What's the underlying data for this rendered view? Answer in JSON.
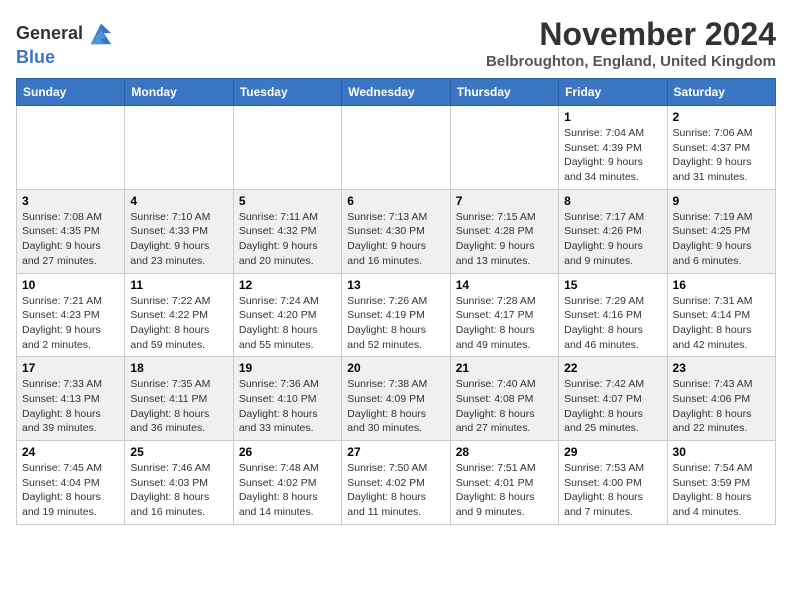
{
  "logo": {
    "line1": "General",
    "line2": "Blue"
  },
  "title": "November 2024",
  "subtitle": "Belbroughton, England, United Kingdom",
  "weekdays": [
    "Sunday",
    "Monday",
    "Tuesday",
    "Wednesday",
    "Thursday",
    "Friday",
    "Saturday"
  ],
  "weeks": [
    [
      {
        "day": "",
        "info": ""
      },
      {
        "day": "",
        "info": ""
      },
      {
        "day": "",
        "info": ""
      },
      {
        "day": "",
        "info": ""
      },
      {
        "day": "",
        "info": ""
      },
      {
        "day": "1",
        "info": "Sunrise: 7:04 AM\nSunset: 4:39 PM\nDaylight: 9 hours and 34 minutes."
      },
      {
        "day": "2",
        "info": "Sunrise: 7:06 AM\nSunset: 4:37 PM\nDaylight: 9 hours and 31 minutes."
      }
    ],
    [
      {
        "day": "3",
        "info": "Sunrise: 7:08 AM\nSunset: 4:35 PM\nDaylight: 9 hours and 27 minutes."
      },
      {
        "day": "4",
        "info": "Sunrise: 7:10 AM\nSunset: 4:33 PM\nDaylight: 9 hours and 23 minutes."
      },
      {
        "day": "5",
        "info": "Sunrise: 7:11 AM\nSunset: 4:32 PM\nDaylight: 9 hours and 20 minutes."
      },
      {
        "day": "6",
        "info": "Sunrise: 7:13 AM\nSunset: 4:30 PM\nDaylight: 9 hours and 16 minutes."
      },
      {
        "day": "7",
        "info": "Sunrise: 7:15 AM\nSunset: 4:28 PM\nDaylight: 9 hours and 13 minutes."
      },
      {
        "day": "8",
        "info": "Sunrise: 7:17 AM\nSunset: 4:26 PM\nDaylight: 9 hours and 9 minutes."
      },
      {
        "day": "9",
        "info": "Sunrise: 7:19 AM\nSunset: 4:25 PM\nDaylight: 9 hours and 6 minutes."
      }
    ],
    [
      {
        "day": "10",
        "info": "Sunrise: 7:21 AM\nSunset: 4:23 PM\nDaylight: 9 hours and 2 minutes."
      },
      {
        "day": "11",
        "info": "Sunrise: 7:22 AM\nSunset: 4:22 PM\nDaylight: 8 hours and 59 minutes."
      },
      {
        "day": "12",
        "info": "Sunrise: 7:24 AM\nSunset: 4:20 PM\nDaylight: 8 hours and 55 minutes."
      },
      {
        "day": "13",
        "info": "Sunrise: 7:26 AM\nSunset: 4:19 PM\nDaylight: 8 hours and 52 minutes."
      },
      {
        "day": "14",
        "info": "Sunrise: 7:28 AM\nSunset: 4:17 PM\nDaylight: 8 hours and 49 minutes."
      },
      {
        "day": "15",
        "info": "Sunrise: 7:29 AM\nSunset: 4:16 PM\nDaylight: 8 hours and 46 minutes."
      },
      {
        "day": "16",
        "info": "Sunrise: 7:31 AM\nSunset: 4:14 PM\nDaylight: 8 hours and 42 minutes."
      }
    ],
    [
      {
        "day": "17",
        "info": "Sunrise: 7:33 AM\nSunset: 4:13 PM\nDaylight: 8 hours and 39 minutes."
      },
      {
        "day": "18",
        "info": "Sunrise: 7:35 AM\nSunset: 4:11 PM\nDaylight: 8 hours and 36 minutes."
      },
      {
        "day": "19",
        "info": "Sunrise: 7:36 AM\nSunset: 4:10 PM\nDaylight: 8 hours and 33 minutes."
      },
      {
        "day": "20",
        "info": "Sunrise: 7:38 AM\nSunset: 4:09 PM\nDaylight: 8 hours and 30 minutes."
      },
      {
        "day": "21",
        "info": "Sunrise: 7:40 AM\nSunset: 4:08 PM\nDaylight: 8 hours and 27 minutes."
      },
      {
        "day": "22",
        "info": "Sunrise: 7:42 AM\nSunset: 4:07 PM\nDaylight: 8 hours and 25 minutes."
      },
      {
        "day": "23",
        "info": "Sunrise: 7:43 AM\nSunset: 4:06 PM\nDaylight: 8 hours and 22 minutes."
      }
    ],
    [
      {
        "day": "24",
        "info": "Sunrise: 7:45 AM\nSunset: 4:04 PM\nDaylight: 8 hours and 19 minutes."
      },
      {
        "day": "25",
        "info": "Sunrise: 7:46 AM\nSunset: 4:03 PM\nDaylight: 8 hours and 16 minutes."
      },
      {
        "day": "26",
        "info": "Sunrise: 7:48 AM\nSunset: 4:02 PM\nDaylight: 8 hours and 14 minutes."
      },
      {
        "day": "27",
        "info": "Sunrise: 7:50 AM\nSunset: 4:02 PM\nDaylight: 8 hours and 11 minutes."
      },
      {
        "day": "28",
        "info": "Sunrise: 7:51 AM\nSunset: 4:01 PM\nDaylight: 8 hours and 9 minutes."
      },
      {
        "day": "29",
        "info": "Sunrise: 7:53 AM\nSunset: 4:00 PM\nDaylight: 8 hours and 7 minutes."
      },
      {
        "day": "30",
        "info": "Sunrise: 7:54 AM\nSunset: 3:59 PM\nDaylight: 8 hours and 4 minutes."
      }
    ]
  ]
}
